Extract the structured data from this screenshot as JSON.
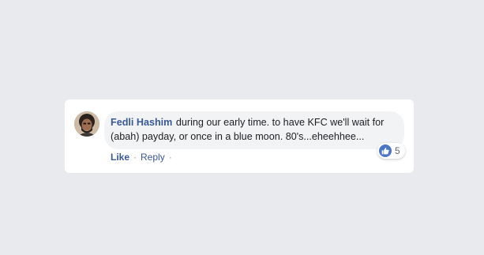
{
  "comment": {
    "author": "Fedli Hashim",
    "text": "during our early time. to have KFC we'll wait for (abah) payday, or once in a blue moon. 80's...eheehhee...",
    "reactions": {
      "icon": "like-thumb-icon",
      "count": "5"
    },
    "actions": {
      "like_label": "Like",
      "reply_label": "Reply",
      "separator": "·"
    }
  },
  "colors": {
    "background": "#e9eaee",
    "card": "#ffffff",
    "bubble": "#f2f3f5",
    "link": "#385898",
    "like_badge": "#4a76c9"
  }
}
